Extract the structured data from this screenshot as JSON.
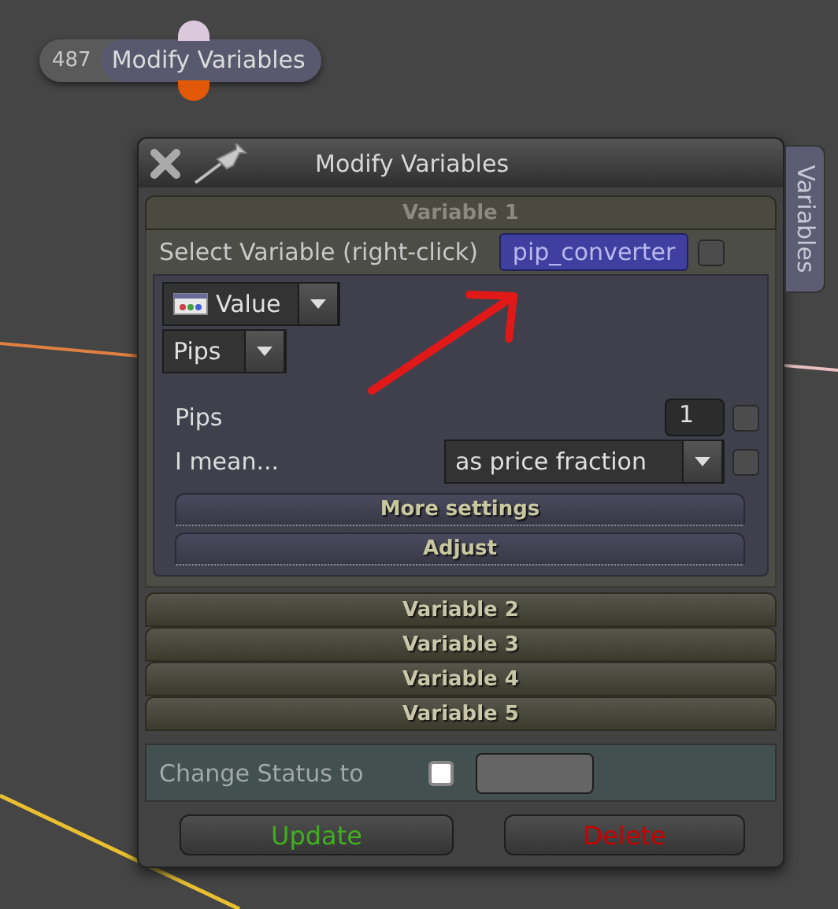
{
  "node": {
    "number": "487",
    "title": "Modify Variables"
  },
  "window": {
    "title": "Modify Variables",
    "side_tab": "Variables"
  },
  "variables": [
    {
      "label": "Variable 1",
      "expanded": true,
      "select_label": "Select Variable (right-click)",
      "variable_name": "pip_converter",
      "checked": false,
      "source": "Value",
      "unit": "Pips",
      "fields": [
        {
          "label": "Pips",
          "kind": "number",
          "value": "1",
          "checked": false
        },
        {
          "label": "I mean...",
          "kind": "dropdown",
          "value": "as price fraction",
          "checked": false
        }
      ],
      "sections": [
        "More settings",
        "Adjust"
      ]
    },
    {
      "label": "Variable 2",
      "expanded": false
    },
    {
      "label": "Variable 3",
      "expanded": false
    },
    {
      "label": "Variable 4",
      "expanded": false
    },
    {
      "label": "Variable 5",
      "expanded": false
    }
  ],
  "change_status": {
    "label": "Change Status to",
    "checked": false
  },
  "buttons": [
    {
      "label": "Update",
      "kind": "update"
    },
    {
      "label": "Delete",
      "kind": "delete"
    }
  ]
}
